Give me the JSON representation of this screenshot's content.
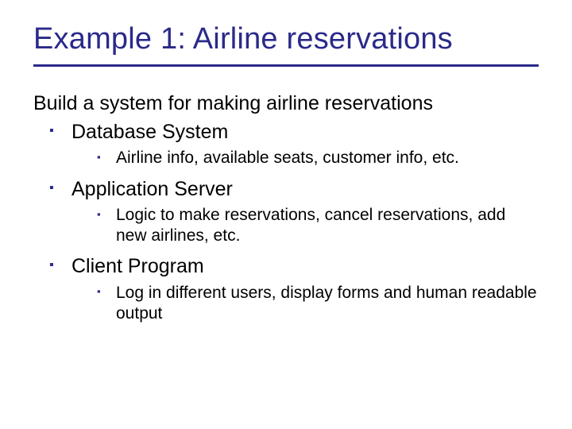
{
  "title": "Example 1: Airline reservations",
  "intro": "Build a system for making airline reservations",
  "bullets": [
    {
      "label": "Database System",
      "sub": [
        "Airline info, available seats, customer info, etc."
      ]
    },
    {
      "label": "Application Server",
      "sub": [
        "Logic to make reservations, cancel reservations, add new airlines, etc."
      ]
    },
    {
      "label": "Client Program",
      "sub": [
        "Log in different users, display forms and human readable output"
      ]
    }
  ]
}
